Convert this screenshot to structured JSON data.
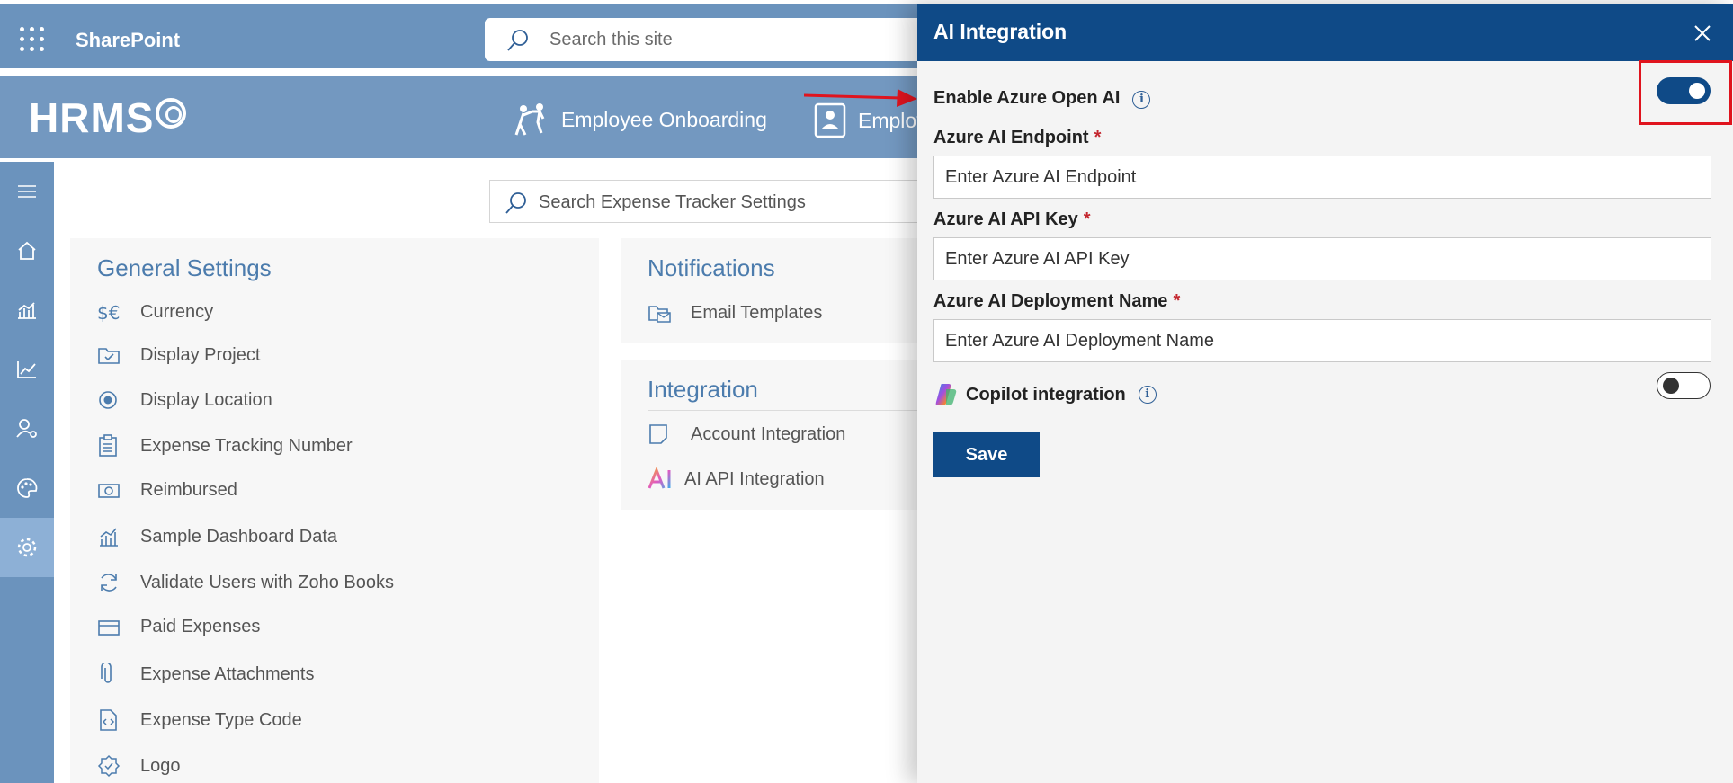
{
  "sharepoint": {
    "title": "SharePoint",
    "search_placeholder": "Search this site"
  },
  "banner": {
    "logo_text": "HRMS",
    "nav": [
      {
        "label": "Employee Onboarding",
        "icon": "onboarding-icon"
      },
      {
        "label": "Employ",
        "icon": "employee-directory-icon"
      }
    ]
  },
  "rail": {
    "items": [
      {
        "icon": "hamburger-menu-icon"
      },
      {
        "icon": "home-icon"
      },
      {
        "icon": "analytics-chart-icon"
      },
      {
        "icon": "trend-line-icon"
      },
      {
        "icon": "user-settings-icon"
      },
      {
        "icon": "palette-icon"
      },
      {
        "icon": "gear-icon",
        "active": true
      }
    ]
  },
  "content": {
    "search_placeholder": "Search Expense Tracker Settings",
    "general": {
      "title": "General Settings",
      "items": [
        {
          "label": "Currency",
          "icon": "currency-icon"
        },
        {
          "label": "Display Project",
          "icon": "project-folder-icon"
        },
        {
          "label": "Display Location",
          "icon": "location-radio-icon"
        },
        {
          "label": "Expense Tracking Number",
          "icon": "clipboard-list-icon"
        },
        {
          "label": "Reimbursed",
          "icon": "money-icon"
        },
        {
          "label": "Sample Dashboard Data",
          "icon": "dashboard-chart-icon"
        },
        {
          "label": "Validate Users with Zoho Books",
          "icon": "sync-icon"
        },
        {
          "label": "Paid Expenses",
          "icon": "card-icon"
        },
        {
          "label": "Expense Attachments",
          "icon": "paperclip-icon"
        },
        {
          "label": "Expense Type Code",
          "icon": "code-file-icon"
        },
        {
          "label": "Logo",
          "icon": "badge-check-icon"
        }
      ]
    },
    "notifications": {
      "title": "Notifications",
      "items": [
        {
          "label": "Email Templates",
          "icon": "email-template-icon"
        }
      ]
    },
    "integration": {
      "title": "Integration",
      "items": [
        {
          "label": "Account Integration",
          "icon": "account-page-icon"
        },
        {
          "label": "AI API Integration",
          "icon": "ai-logo-icon"
        }
      ]
    }
  },
  "panel": {
    "title": "AI Integration",
    "enable_label": "Enable Azure Open AI",
    "enable_on": true,
    "endpoint_label": "Azure AI Endpoint",
    "endpoint_placeholder": "Enter Azure AI Endpoint",
    "apikey_label": "Azure AI API Key",
    "apikey_placeholder": "Enter Azure AI API Key",
    "deployment_label": "Azure AI Deployment Name",
    "deployment_placeholder": "Enter Azure AI Deployment Name",
    "required_mark": "*",
    "copilot_label": "Copilot integration",
    "copilot_on": false,
    "save_label": "Save",
    "info_glyph": "i"
  },
  "colors": {
    "brand": "#0f4a87",
    "sharepoint_bar": "#6b93bd",
    "section_title": "#4c7cad",
    "annotation": "#e0141e"
  }
}
